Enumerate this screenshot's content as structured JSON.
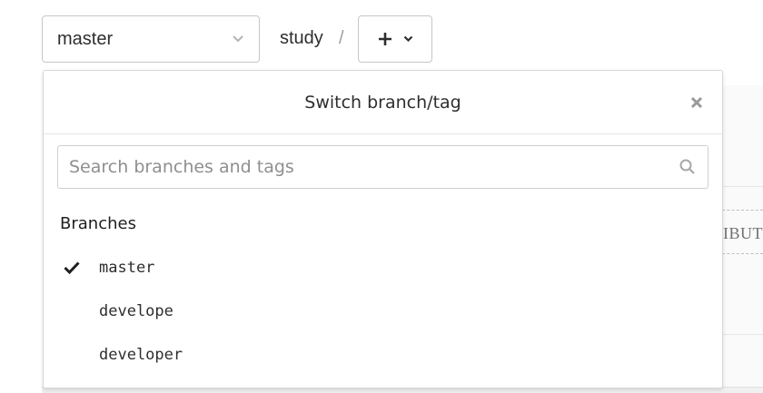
{
  "toolbar": {
    "branch_select_value": "master",
    "path_crumb": "study",
    "path_separator": "/"
  },
  "dropdown": {
    "title": "Switch branch/tag",
    "search_placeholder": "Search branches and tags",
    "search_value": "",
    "section_title": "Branches",
    "branches": [
      {
        "name": "master",
        "selected": true
      },
      {
        "name": "develope",
        "selected": false
      },
      {
        "name": "developer",
        "selected": false
      }
    ]
  },
  "background": {
    "truncated_text": "IBUTI"
  },
  "icons": {
    "branch_select_chevron": "chevron-down-icon",
    "add_button": "plus-icon",
    "add_button_caret": "caret-down-icon",
    "close": "close-icon",
    "search": "search-icon",
    "selected_branch": "check-icon"
  },
  "colors": {
    "text": "#2e2e2e",
    "muted": "#8f8f8f",
    "border": "#c7c7c7"
  }
}
